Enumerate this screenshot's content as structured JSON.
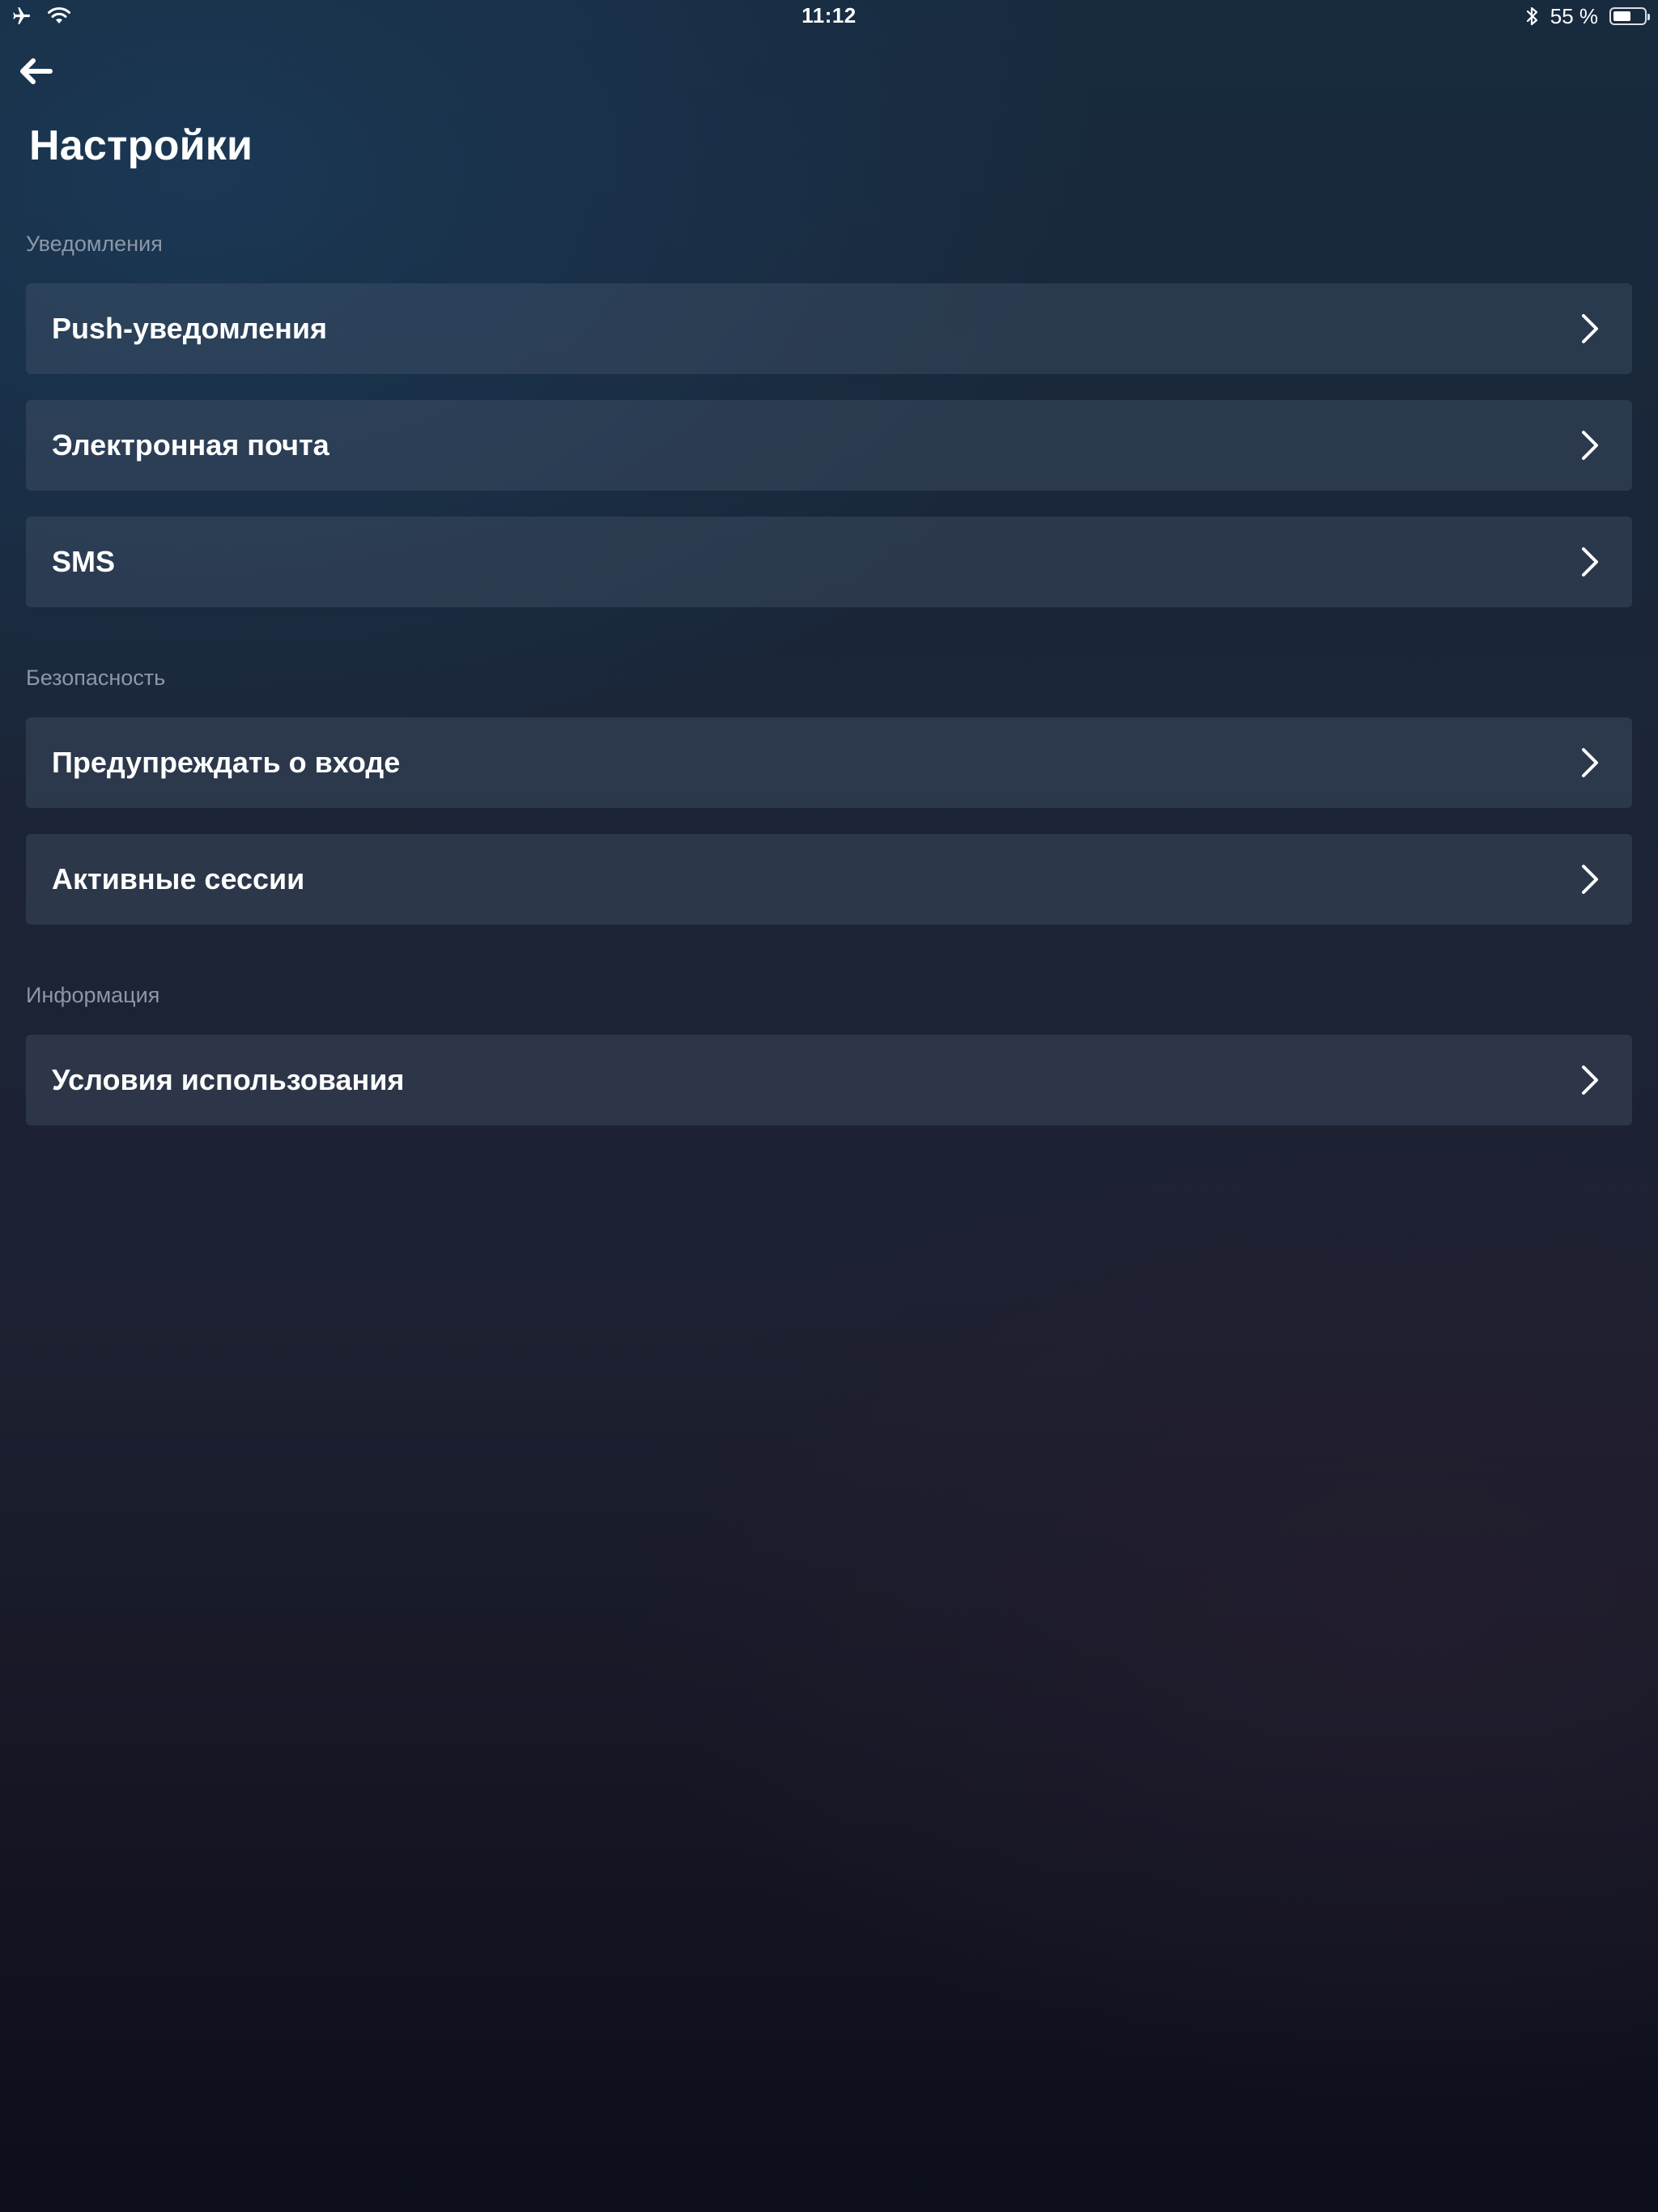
{
  "status_bar": {
    "time": "11:12",
    "battery_text": "55 %",
    "battery_level": 0.55,
    "icons": [
      "airplane-icon",
      "wifi-icon",
      "bluetooth-icon",
      "battery-icon"
    ]
  },
  "header": {
    "back_icon": "arrow-left-icon",
    "title": "Настройки"
  },
  "sections": [
    {
      "heading": "Уведомления",
      "items": [
        {
          "label": "Push-уведомления",
          "icon": "chevron-right-icon"
        },
        {
          "label": "Электронная почта",
          "icon": "chevron-right-icon"
        },
        {
          "label": "SMS",
          "icon": "chevron-right-icon"
        }
      ]
    },
    {
      "heading": "Безопасность",
      "items": [
        {
          "label": "Предупреждать о входе",
          "icon": "chevron-right-icon"
        },
        {
          "label": "Активные сессии",
          "icon": "chevron-right-icon"
        }
      ]
    },
    {
      "heading": "Информация",
      "items": [
        {
          "label": "Условия использования",
          "icon": "chevron-right-icon"
        }
      ]
    }
  ]
}
